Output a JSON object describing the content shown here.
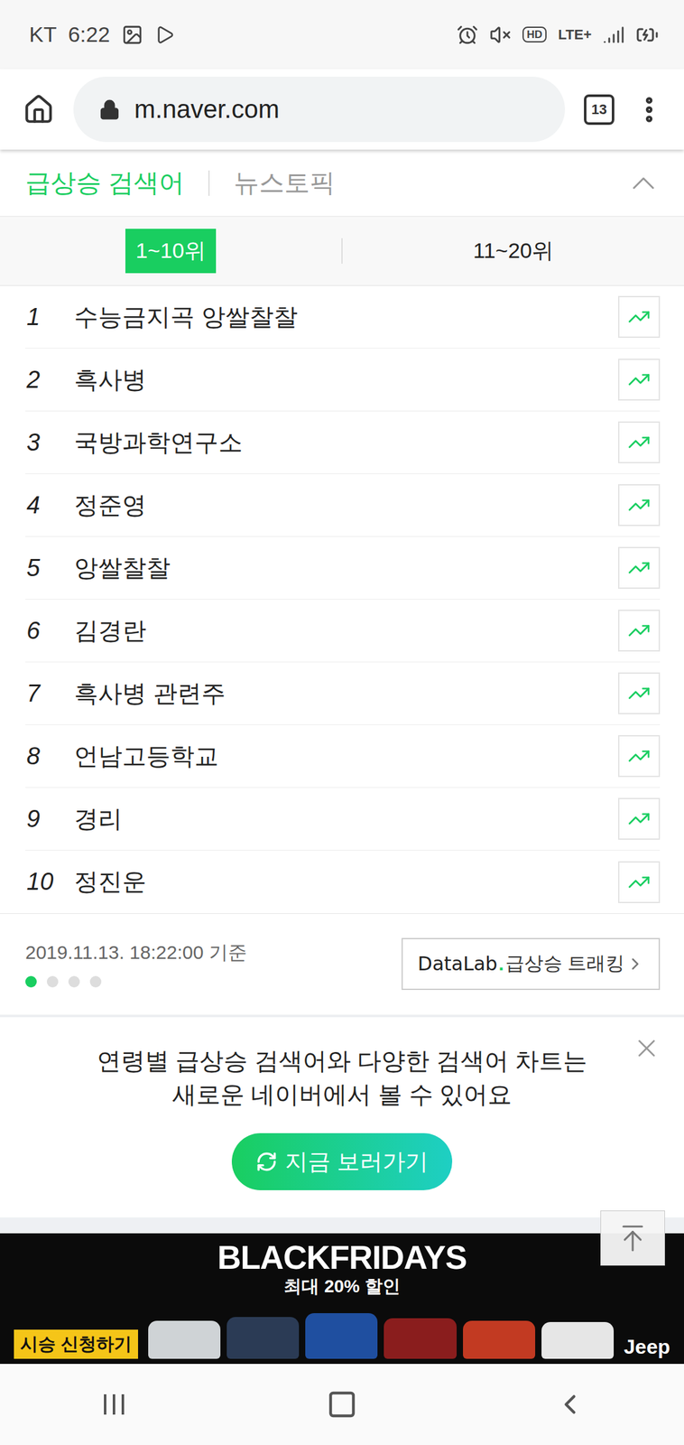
{
  "status_bar": {
    "carrier": "KT",
    "time": "6:22",
    "hd": "HD",
    "network": "LTE+"
  },
  "browser": {
    "url": "m.naver.com",
    "tab_count": "13"
  },
  "section_tabs": [
    {
      "label": "급상승 검색어",
      "selected": true
    },
    {
      "label": "뉴스토픽",
      "selected": false
    }
  ],
  "section_expanded": true,
  "range_tabs": [
    {
      "label": "1~10위",
      "selected": true
    },
    {
      "label": "11~20위",
      "selected": false
    }
  ],
  "rankings": [
    {
      "rank": "1",
      "keyword": "수능금지곡 앙쌀찰찰"
    },
    {
      "rank": "2",
      "keyword": "흑사병"
    },
    {
      "rank": "3",
      "keyword": "국방과학연구소"
    },
    {
      "rank": "4",
      "keyword": "정준영"
    },
    {
      "rank": "5",
      "keyword": "앙쌀찰찰"
    },
    {
      "rank": "6",
      "keyword": "김경란"
    },
    {
      "rank": "7",
      "keyword": "흑사병 관련주"
    },
    {
      "rank": "8",
      "keyword": "언남고등학교"
    },
    {
      "rank": "9",
      "keyword": "경리"
    },
    {
      "rank": "10",
      "keyword": "정진운"
    }
  ],
  "timestamp": "2019.11.13. 18:22:00 기준",
  "pager_dots": [
    {
      "selected": true
    },
    {
      "selected": false
    },
    {
      "selected": false
    },
    {
      "selected": false
    }
  ],
  "datalab_button": {
    "brand": "DataLab",
    "separator": ".",
    "label": "급상승 트래킹"
  },
  "promo": {
    "lines": [
      "연령별 급상승 검색어와 다양한 검색어 차트는",
      "새로운 네이버에서 볼 수 있어요"
    ],
    "button": "지금 보러가기"
  },
  "ad": {
    "headline": "BLACKFRIDAYS",
    "subline": "최대 20% 할인",
    "cta": "시승 신청하기",
    "brand": "Jeep"
  }
}
